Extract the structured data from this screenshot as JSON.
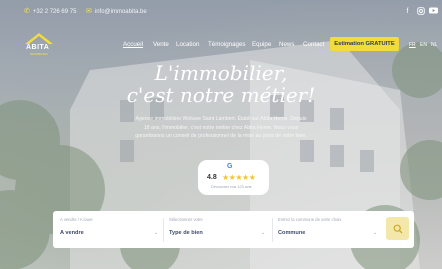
{
  "topbar": {
    "phone": "+32 2 726 69 75",
    "email": "info@immoabita.be",
    "social_icons": [
      "facebook-icon",
      "instagram-icon",
      "youtube-icon"
    ]
  },
  "logo": {
    "name": "ABITA",
    "tagline": "IMMOBILIER"
  },
  "nav": {
    "items": [
      "Accueil",
      "Vente",
      "Location",
      "Témoignages",
      "Equipe",
      "News",
      "Contact"
    ],
    "active": "Accueil",
    "cta_label": "Estimation GRATUITE",
    "languages": [
      "FR",
      "EN",
      "NL"
    ],
    "active_language": "FR"
  },
  "hero": {
    "headline_line1": "L'immobilier,",
    "headline_line2": "c'est notre métier!",
    "paragraph": "Agence immobilière Woluwe Saint Lambert. Établi sur Abita Home. Depuis 18 ans, l'immobilier, c'est notre métier chez Abita Home. Nous vous garantissons un conseil de professionnel de la mise au point de votre bien."
  },
  "rating": {
    "score": "4.8",
    "reviews_label": "Découvrez nos 123 avis",
    "stars": 5
  },
  "search": {
    "fields": [
      {
        "label": "A vendre / A louer",
        "value": "A vendre"
      },
      {
        "label": "Sélectionner votre",
        "value": "Type de bien"
      },
      {
        "label": "Entrez la commune de votre choix",
        "value": "Commune"
      }
    ]
  },
  "colors": {
    "accent": "#f2dc3c",
    "navy": "#2d3a5c",
    "search_button": "#f3e8a9"
  }
}
